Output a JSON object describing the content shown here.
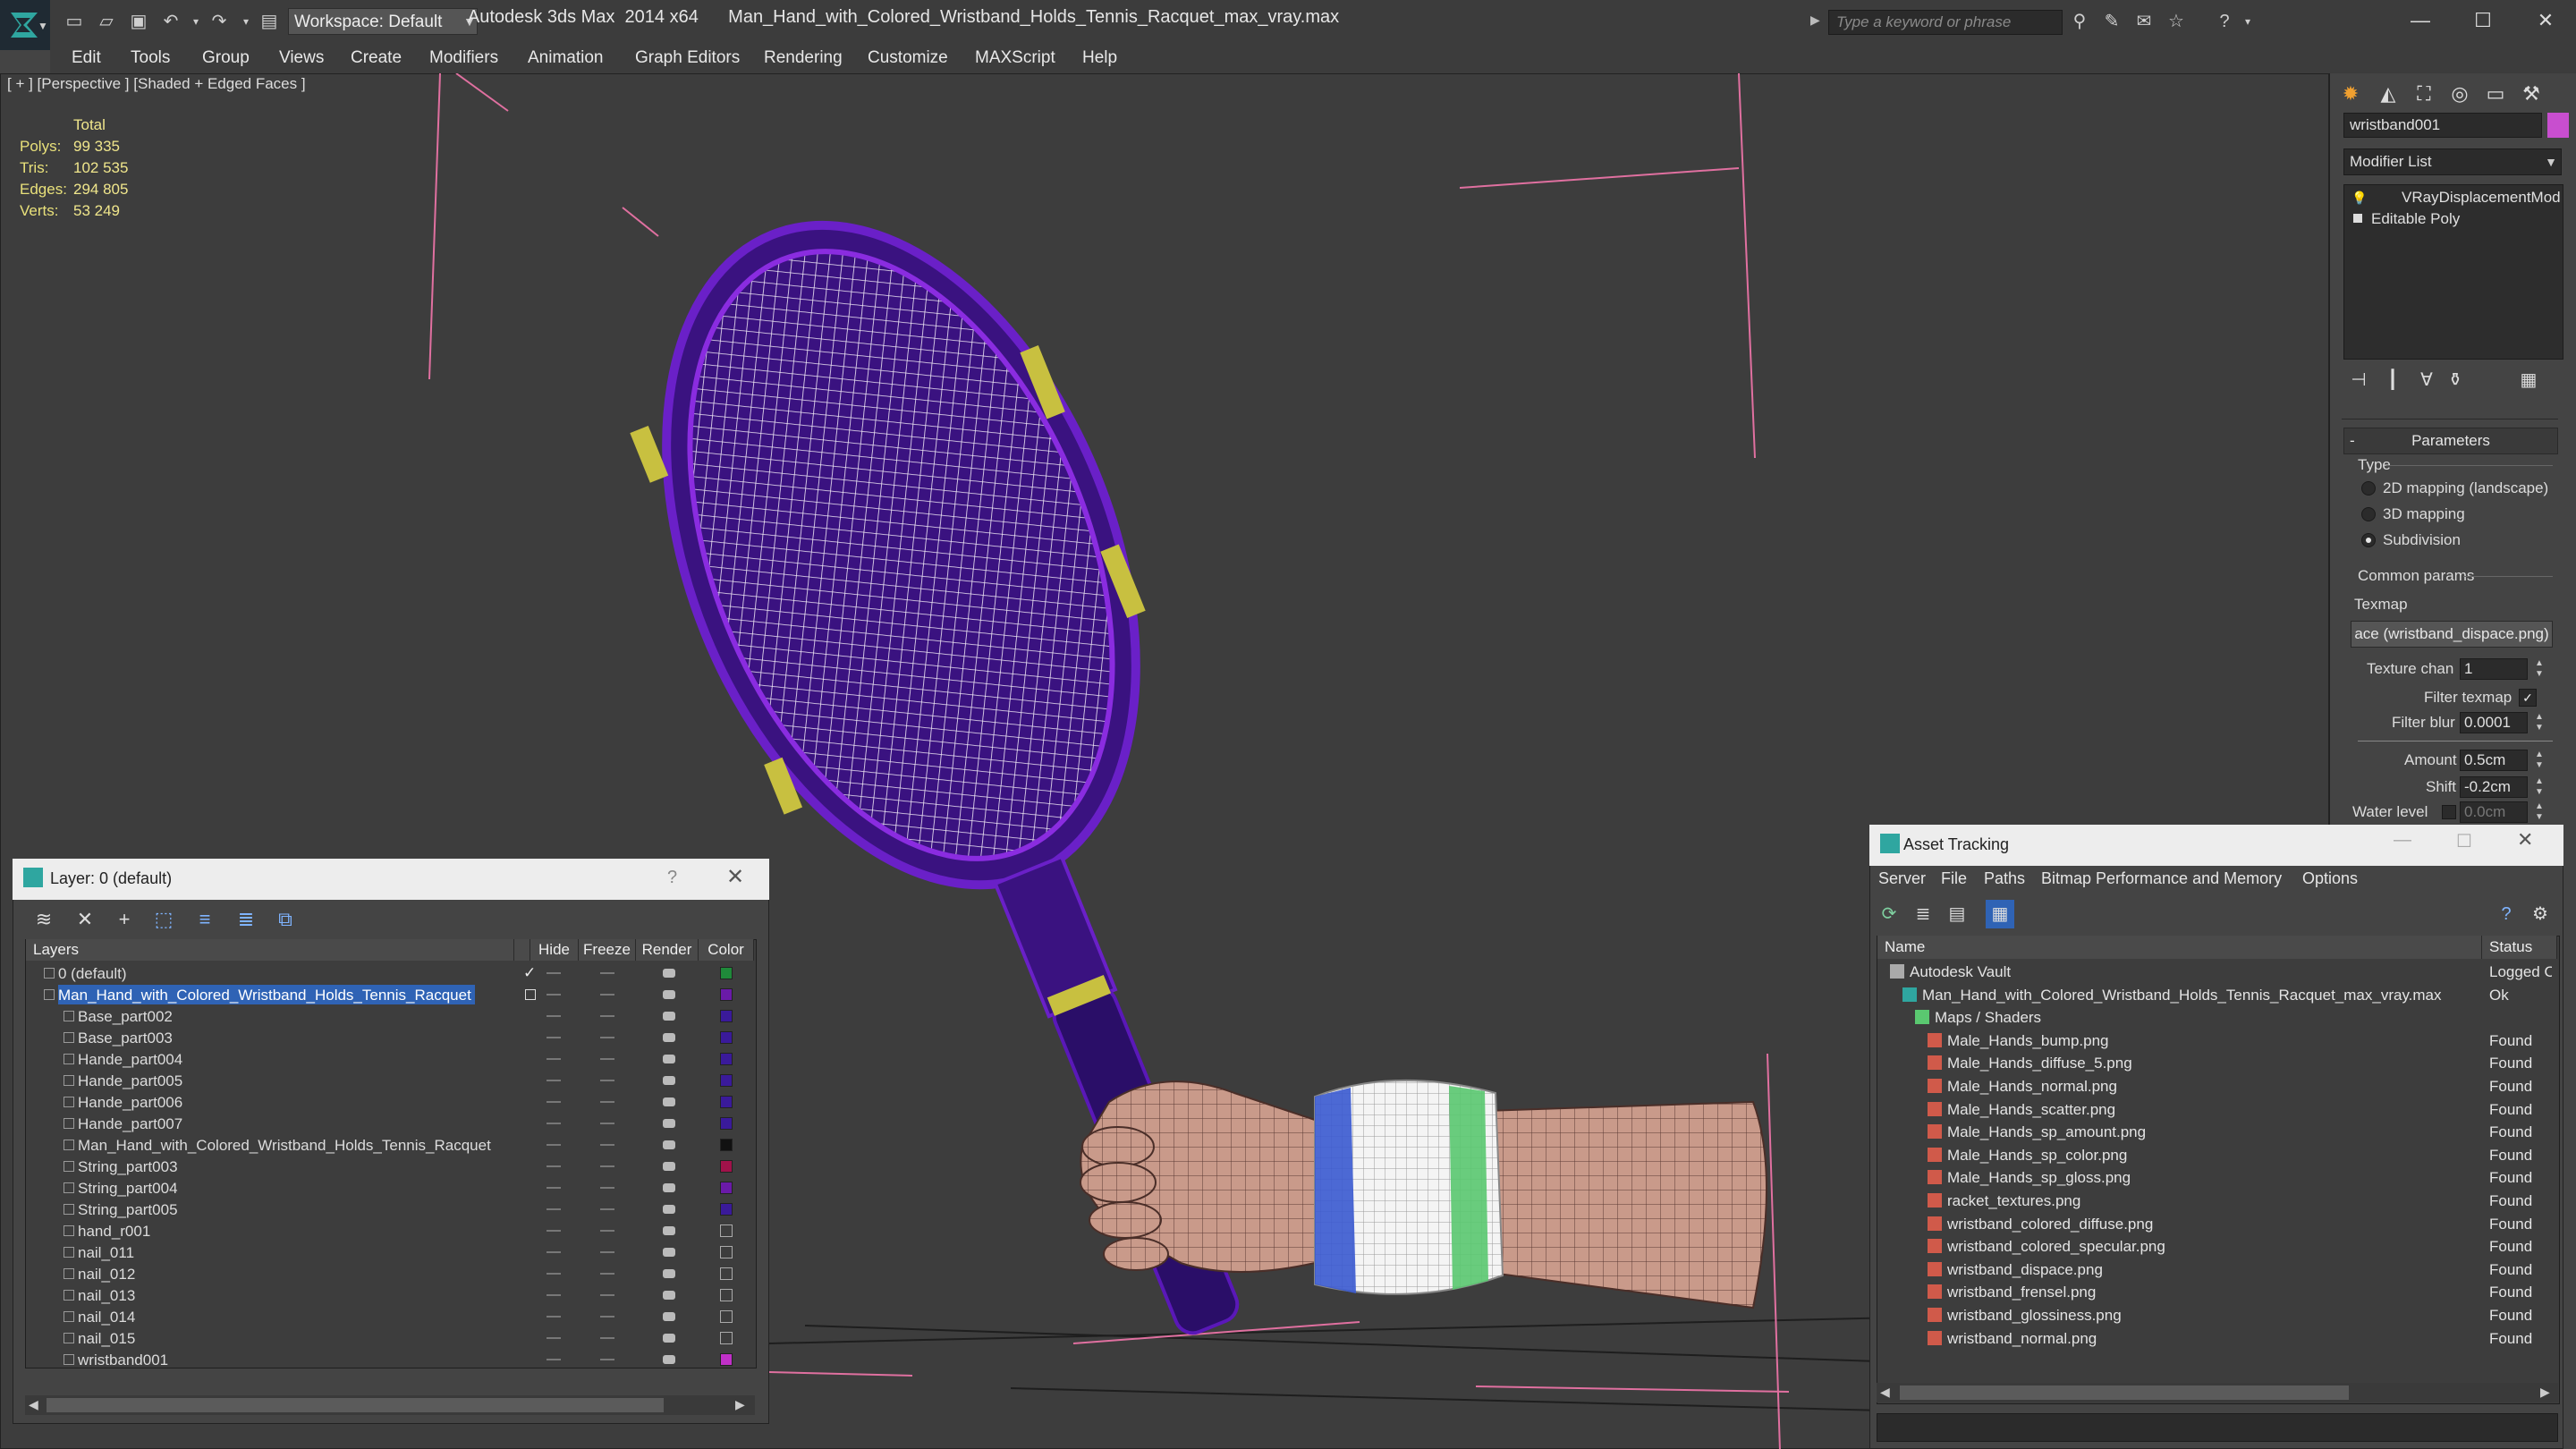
{
  "titlebar": {
    "workspace": "Workspace: Default",
    "app_title": "Autodesk 3ds Max  2014 x64      Man_Hand_with_Colored_Wristband_Holds_Tennis_Racquet_max_vray.max",
    "search_placeholder": "Type a keyword or phrase"
  },
  "menu": [
    "Edit",
    "Tools",
    "Group",
    "Views",
    "Create",
    "Modifiers",
    "Animation",
    "Graph Editors",
    "Rendering",
    "Customize",
    "MAXScript",
    "Help"
  ],
  "viewport": {
    "label": "[ + ] [Perspective ] [Shaded + Edged Faces ]",
    "stats_total": "Total",
    "stats": [
      {
        "key": "Polys:",
        "value": "99 335"
      },
      {
        "key": "Tris:",
        "value": "102 535"
      },
      {
        "key": "Edges:",
        "value": "294 805"
      },
      {
        "key": "Verts:",
        "value": "53 249"
      }
    ]
  },
  "command_panel": {
    "object_name": "wristband001",
    "object_color": "#c84ecf",
    "modifier_list": "Modifier List",
    "stack": [
      "VRayDisplacementMod",
      "Editable Poly"
    ],
    "params_title": "Parameters",
    "type_label": "Type",
    "type_options": [
      "2D mapping (landscape)",
      "3D mapping",
      "Subdivision"
    ],
    "type_selected": "Subdivision",
    "common_params": "Common params",
    "texmap_label": "Texmap",
    "texmap_value": "ace (wristband_dispace.png)",
    "texture_chan_label": "Texture chan",
    "texture_chan_value": "1",
    "filter_texmap_label": "Filter texmap",
    "filter_blur_label": "Filter blur",
    "filter_blur_value": "0.0001",
    "amount_label": "Amount",
    "amount_value": "0.5cm",
    "shift_label": "Shift",
    "shift_value": "-0.2cm",
    "water_level_label": "Water level",
    "water_level_value": "0.0cm"
  },
  "layer_explorer": {
    "title": "Layer: 0 (default)",
    "help": "?",
    "columns": [
      "Layers",
      "Hide",
      "Freeze",
      "Render",
      "Color"
    ],
    "rows": [
      {
        "name": "0 (default)",
        "indent": 1,
        "color": "#1f8a3a",
        "check": true
      },
      {
        "name": "Man_Hand_with_Colored_Wristband_Holds_Tennis_Racquet",
        "indent": 1,
        "color": "#6a1aa8",
        "selected": true
      },
      {
        "name": "Base_part002",
        "indent": 2,
        "color": "#3a1a9a"
      },
      {
        "name": "Base_part003",
        "indent": 2,
        "color": "#3a1a9a"
      },
      {
        "name": "Hande_part004",
        "indent": 2,
        "color": "#3a1a9a"
      },
      {
        "name": "Hande_part005",
        "indent": 2,
        "color": "#3a1a9a"
      },
      {
        "name": "Hande_part006",
        "indent": 2,
        "color": "#3a1a9a"
      },
      {
        "name": "Hande_part007",
        "indent": 2,
        "color": "#3a1a9a"
      },
      {
        "name": "Man_Hand_with_Colored_Wristband_Holds_Tennis_Racquet",
        "indent": 2,
        "color": "#111111"
      },
      {
        "name": "String_part003",
        "indent": 2,
        "color": "#a0124a"
      },
      {
        "name": "String_part004",
        "indent": 2,
        "color": "#6a1aa8"
      },
      {
        "name": "String_part005",
        "indent": 2,
        "color": "#3a1a9a"
      },
      {
        "name": "hand_r001",
        "indent": 2,
        "color": "#3d3d3d"
      },
      {
        "name": "nail_011",
        "indent": 2,
        "color": "#3d3d3d"
      },
      {
        "name": "nail_012",
        "indent": 2,
        "color": "#3d3d3d"
      },
      {
        "name": "nail_013",
        "indent": 2,
        "color": "#3d3d3d"
      },
      {
        "name": "nail_014",
        "indent": 2,
        "color": "#3d3d3d"
      },
      {
        "name": "nail_015",
        "indent": 2,
        "color": "#3d3d3d"
      },
      {
        "name": "wristband001",
        "indent": 2,
        "color": "#c030c8"
      }
    ]
  },
  "asset_tracking": {
    "title": "Asset Tracking",
    "menu": [
      "Server",
      "File",
      "Paths",
      "Bitmap Performance and Memory",
      "Options"
    ],
    "columns": [
      "Name",
      "Status"
    ],
    "rows": [
      {
        "name": "Autodesk Vault",
        "status": "Logged O",
        "level": 0,
        "icon": "vault"
      },
      {
        "name": "Man_Hand_with_Colored_Wristband_Holds_Tennis_Racquet_max_vray.max",
        "status": "Ok",
        "level": 1,
        "icon": "max"
      },
      {
        "name": "Maps / Shaders",
        "status": "",
        "level": 2,
        "icon": "maps"
      },
      {
        "name": "Male_Hands_bump.png",
        "status": "Found",
        "level": 3,
        "icon": "png"
      },
      {
        "name": "Male_Hands_diffuse_5.png",
        "status": "Found",
        "level": 3,
        "icon": "png"
      },
      {
        "name": "Male_Hands_normal.png",
        "status": "Found",
        "level": 3,
        "icon": "png"
      },
      {
        "name": "Male_Hands_scatter.png",
        "status": "Found",
        "level": 3,
        "icon": "png"
      },
      {
        "name": "Male_Hands_sp_amount.png",
        "status": "Found",
        "level": 3,
        "icon": "png"
      },
      {
        "name": "Male_Hands_sp_color.png",
        "status": "Found",
        "level": 3,
        "icon": "png"
      },
      {
        "name": "Male_Hands_sp_gloss.png",
        "status": "Found",
        "level": 3,
        "icon": "png"
      },
      {
        "name": "racket_textures.png",
        "status": "Found",
        "level": 3,
        "icon": "png"
      },
      {
        "name": "wristband_colored_diffuse.png",
        "status": "Found",
        "level": 3,
        "icon": "png"
      },
      {
        "name": "wristband_colored_specular.png",
        "status": "Found",
        "level": 3,
        "icon": "png"
      },
      {
        "name": "wristband_dispace.png",
        "status": "Found",
        "level": 3,
        "icon": "png"
      },
      {
        "name": "wristband_frensel.png",
        "status": "Found",
        "level": 3,
        "icon": "png"
      },
      {
        "name": "wristband_glossiness.png",
        "status": "Found",
        "level": 3,
        "icon": "png"
      },
      {
        "name": "wristband_normal.png",
        "status": "Found",
        "level": 3,
        "icon": "png"
      }
    ]
  }
}
